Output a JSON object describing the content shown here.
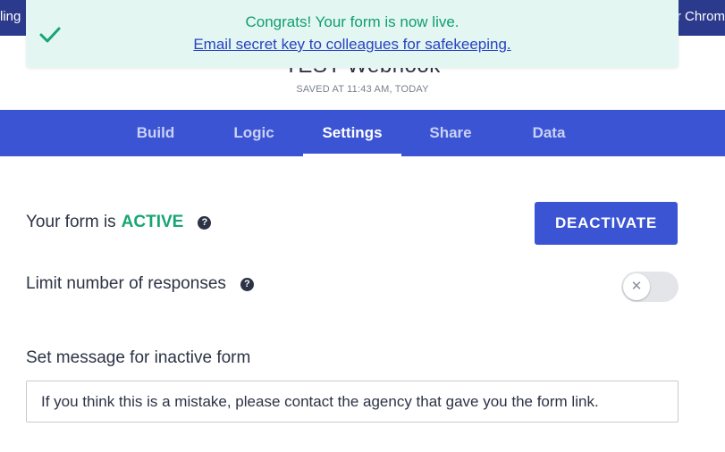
{
  "banner": {
    "left_edge_text": "ling",
    "right_edge_text": "r Chrom"
  },
  "header": {
    "form_title": "TEST Webhook",
    "saved_text": "SAVED AT 11:43 AM, TODAY"
  },
  "toast": {
    "icon": "check-icon",
    "message": "Congrats! Your form is now live.",
    "link_text": "Email secret key to colleagues for safekeeping."
  },
  "tabs": [
    {
      "label": "Build"
    },
    {
      "label": "Logic"
    },
    {
      "label": "Settings"
    },
    {
      "label": "Share"
    },
    {
      "label": "Data"
    }
  ],
  "settings": {
    "status_prefix": "Your form is",
    "status_value": "ACTIVE",
    "deactivate_label": "DEACTIVATE",
    "limit_label": "Limit number of responses",
    "toggle_icon": "close-icon",
    "inactive_message_label": "Set message for inactive form",
    "inactive_message_value": "If you think this is a mistake, please contact the agency that gave you the form link."
  },
  "colors": {
    "primary": "#3b54d3",
    "success": "#17a673",
    "toast_bg": "#e4f6f1",
    "link": "#2643c4"
  }
}
